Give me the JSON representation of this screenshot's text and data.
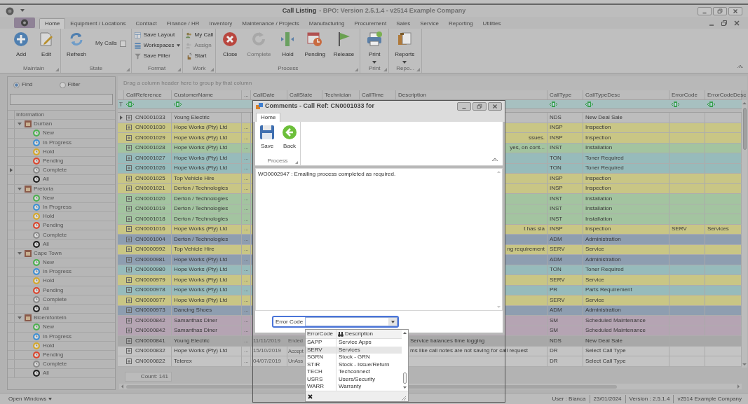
{
  "window": {
    "title": "Call Listing",
    "subtitle": "- BPO: Version 2.5.1.4 - v2514 Example Company"
  },
  "ribbon_tabs": [
    {
      "label": "Home",
      "selected": true
    },
    {
      "label": "Equipment / Locations",
      "selected": false
    },
    {
      "label": "Contract",
      "selected": false
    },
    {
      "label": "Finance / HR",
      "selected": false
    },
    {
      "label": "Inventory",
      "selected": false
    },
    {
      "label": "Maintenance / Projects",
      "selected": false
    },
    {
      "label": "Manufacturing",
      "selected": false
    },
    {
      "label": "Procurement",
      "selected": false
    },
    {
      "label": "Sales",
      "selected": false
    },
    {
      "label": "Service",
      "selected": false
    },
    {
      "label": "Reporting",
      "selected": false
    },
    {
      "label": "Utilities",
      "selected": false
    }
  ],
  "ribbon_groups": [
    {
      "label": "Maintain",
      "items": [
        {
          "kind": "large",
          "label": "Add",
          "disabled": false,
          "dropdown": false
        },
        {
          "kind": "large",
          "label": "Edit",
          "disabled": false,
          "dropdown": false
        }
      ]
    },
    {
      "label": "State",
      "items": [
        {
          "kind": "large",
          "label": "Refresh",
          "disabled": false,
          "dropdown": false
        },
        {
          "kind": "check",
          "label": "My Calls",
          "checked": false
        }
      ]
    },
    {
      "label": "Format",
      "items": [
        {
          "kind": "small",
          "label": "Save Layout",
          "disabled": false,
          "dropdown": false
        },
        {
          "kind": "small",
          "label": "Workspaces",
          "disabled": false,
          "dropdown": true
        },
        {
          "kind": "small",
          "label": "Save Filter",
          "disabled": false,
          "dropdown": false
        }
      ]
    },
    {
      "label": "Work",
      "items": [
        {
          "kind": "small",
          "label": "My Call",
          "disabled": false,
          "dropdown": false
        },
        {
          "kind": "small",
          "label": "Assign",
          "disabled": true,
          "dropdown": false
        },
        {
          "kind": "small",
          "label": "Start",
          "disabled": false,
          "dropdown": false
        }
      ]
    },
    {
      "label": "Process",
      "items": [
        {
          "kind": "large",
          "label": "Close",
          "disabled": false,
          "dropdown": false
        },
        {
          "kind": "large",
          "label": "Complete",
          "disabled": true,
          "dropdown": false
        },
        {
          "kind": "large",
          "label": "Hold",
          "disabled": false,
          "dropdown": false
        },
        {
          "kind": "large",
          "label": "Pending",
          "disabled": false,
          "dropdown": false
        },
        {
          "kind": "large",
          "label": "Release",
          "disabled": false,
          "dropdown": false
        }
      ]
    },
    {
      "label": "Print",
      "items": [
        {
          "kind": "large",
          "label": "Print",
          "disabled": false,
          "dropdown": true
        }
      ]
    },
    {
      "label": "Repo...",
      "items": [
        {
          "kind": "large",
          "label": "Reports",
          "disabled": false,
          "dropdown": true
        }
      ]
    }
  ],
  "search": {
    "options": [
      {
        "label": "Find",
        "selected": true
      },
      {
        "label": "Filter",
        "selected": false
      }
    ]
  },
  "tree": {
    "header": "Information",
    "items": [
      {
        "label": "Durban",
        "expanded": true,
        "selected": false,
        "children": [
          {
            "label": "New",
            "color": "#4caf50",
            "selected": false
          },
          {
            "label": "In Progress",
            "color": "#3f8fd2",
            "selected": false
          },
          {
            "label": "Hold",
            "color": "#d4a72c",
            "selected": false
          },
          {
            "label": "Pending",
            "color": "#d9462f",
            "selected": false
          },
          {
            "label": "Complete",
            "color": "#8a8a8a",
            "selected": true
          },
          {
            "label": "All",
            "color": "#222222",
            "selected": false
          }
        ]
      },
      {
        "label": "Pretoria",
        "expanded": true,
        "selected": false,
        "children": [
          {
            "label": "New",
            "color": "#4caf50",
            "selected": false
          },
          {
            "label": "In Progress",
            "color": "#3f8fd2",
            "selected": false
          },
          {
            "label": "Hold",
            "color": "#d4a72c",
            "selected": false
          },
          {
            "label": "Pending",
            "color": "#d9462f",
            "selected": false
          },
          {
            "label": "Complete",
            "color": "#8a8a8a",
            "selected": false
          },
          {
            "label": "All",
            "color": "#222222",
            "selected": false
          }
        ]
      },
      {
        "label": "Cape Town",
        "expanded": true,
        "selected": false,
        "children": [
          {
            "label": "New",
            "color": "#4caf50",
            "selected": false
          },
          {
            "label": "In Progress",
            "color": "#3f8fd2",
            "selected": false
          },
          {
            "label": "Hold",
            "color": "#d4a72c",
            "selected": false
          },
          {
            "label": "Pending",
            "color": "#d9462f",
            "selected": false
          },
          {
            "label": "Complete",
            "color": "#8a8a8a",
            "selected": false
          },
          {
            "label": "All",
            "color": "#222222",
            "selected": false
          }
        ]
      },
      {
        "label": "Bloemfontein",
        "expanded": true,
        "selected": false,
        "children": [
          {
            "label": "New",
            "color": "#4caf50",
            "selected": false
          },
          {
            "label": "In Progress",
            "color": "#3f8fd2",
            "selected": false
          },
          {
            "label": "Hold",
            "color": "#d4a72c",
            "selected": false
          },
          {
            "label": "Pending",
            "color": "#d9462f",
            "selected": false
          },
          {
            "label": "Complete",
            "color": "#8a8a8a",
            "selected": false
          },
          {
            "label": "All",
            "color": "#222222",
            "selected": false
          }
        ]
      }
    ]
  },
  "table": {
    "group_hint": "Drag a column header here to group by that column",
    "columns": [
      {
        "label": "CallReference",
        "filter": true
      },
      {
        "label": "CustomerName",
        "filter": true
      },
      {
        "label": "..."
      },
      {
        "label": "CallDate"
      },
      {
        "label": "CallState"
      },
      {
        "label": "Technician"
      },
      {
        "label": "CallTime"
      },
      {
        "label": "Description"
      },
      {
        "label": "CallType",
        "filter": true
      },
      {
        "label": "CallTypeDesc",
        "filter": true
      },
      {
        "label": "ErrorCode",
        "filter": true
      },
      {
        "label": "ErrorCodeDesc",
        "filter": true
      }
    ],
    "rows": [
      {
        "ref": "CN0001033",
        "customer": "Young Electric",
        "call_type": "NDS",
        "call_type_desc": "New Deal Sale",
        "color": "#bdbdbd",
        "selected": true
      },
      {
        "ref": "CN0001030",
        "customer": "Hope Works (Pty) Ltd",
        "more": "...",
        "call_type": "INSP",
        "call_type_desc": "Inspection",
        "color": "#c9c685",
        "selected": false
      },
      {
        "ref": "CN0001029",
        "customer": "Hope Works (Pty) Ltd",
        "more": "...",
        "description": "ssues.",
        "call_type": "INSP",
        "call_type_desc": "Inspection",
        "color": "#c9c685",
        "selected": false
      },
      {
        "ref": "CN0001028",
        "customer": "Hope Works (Pty) Ltd",
        "more": "...",
        "description": "yes, on cont...",
        "call_type": "INST",
        "call_type_desc": "Installation",
        "color": "#a3c4a0",
        "selected": false
      },
      {
        "ref": "CN0001027",
        "customer": "Hope Works (Pty) Ltd",
        "more": "...",
        "call_type": "TON",
        "call_type_desc": "Toner Required",
        "color": "#97bbbb",
        "selected": false
      },
      {
        "ref": "CN0001026",
        "customer": "Hope Works (Pty) Ltd",
        "more": "...",
        "call_type": "TON",
        "call_type_desc": "Toner Required",
        "color": "#97bbbb",
        "selected": false
      },
      {
        "ref": "CN0001025",
        "customer": "Top Vehicle Hire",
        "more": "...",
        "call_type": "INSP",
        "call_type_desc": "Inspection",
        "color": "#c9c685",
        "selected": false
      },
      {
        "ref": "CN0001021",
        "customer": "Derton / Technologies",
        "more": "...",
        "call_type": "INSP",
        "call_type_desc": "Inspection",
        "color": "#c9c685",
        "selected": false
      },
      {
        "ref": "CN0001020",
        "customer": "Derton / Technologies",
        "more": "...",
        "call_type": "INST",
        "call_type_desc": "Installation",
        "color": "#a3c4a0",
        "selected": false
      },
      {
        "ref": "CN0001019",
        "customer": "Derton / Technologies",
        "more": "...",
        "call_type": "INST",
        "call_type_desc": "Installation",
        "color": "#a3c4a0",
        "selected": false
      },
      {
        "ref": "CN0001018",
        "customer": "Derton / Technologies",
        "more": "...",
        "call_type": "INST",
        "call_type_desc": "Installation",
        "color": "#a3c4a0",
        "selected": false
      },
      {
        "ref": "CN0001016",
        "customer": "Hope Works (Pty) Ltd",
        "more": "...",
        "description": "t has sla",
        "call_type": "INSP",
        "call_type_desc": "Inspection",
        "error_code": "SERV",
        "error_code_desc": "Services",
        "color": "#c9c685",
        "selected": false
      },
      {
        "ref": "CN0001004",
        "customer": "Derton / Technologies",
        "more": "...",
        "call_type": "ADM",
        "call_type_desc": "Administration",
        "color": "#8e9eb0",
        "selected": false
      },
      {
        "ref": "CN0000992",
        "customer": "Top Vehicle Hire",
        "more": "...",
        "description": "ng requirement",
        "call_type": "SERV",
        "call_type_desc": "Service",
        "color": "#c9c685",
        "selected": false
      },
      {
        "ref": "CN0000981",
        "customer": "Hope Works (Pty) Ltd",
        "more": "...",
        "call_type": "ADM",
        "call_type_desc": "Administration",
        "color": "#8e9eb0",
        "selected": false
      },
      {
        "ref": "CN0000980",
        "customer": "Hope Works (Pty) Ltd",
        "more": "...",
        "call_type": "TON",
        "call_type_desc": "Toner Required",
        "color": "#97bbbb",
        "selected": false
      },
      {
        "ref": "CN0000979",
        "customer": "Hope Works (Pty) Ltd",
        "more": "...",
        "call_type": "SERV",
        "call_type_desc": "Service",
        "color": "#c9c685",
        "selected": false
      },
      {
        "ref": "CN0000978",
        "customer": "Hope Works (Pty) Ltd",
        "more": "...",
        "call_type": "PR",
        "call_type_desc": "Parts Requirement",
        "color": "#97bbbb",
        "selected": false
      },
      {
        "ref": "CN0000977",
        "customer": "Hope Works (Pty) Ltd",
        "more": "...",
        "call_type": "SERV",
        "call_type_desc": "Service",
        "color": "#c9c685",
        "selected": false
      },
      {
        "ref": "CN0000973",
        "customer": "Dancing Shoes",
        "more": "...",
        "call_type": "ADM",
        "call_type_desc": "Administration",
        "color": "#8e9eb0",
        "selected": false
      },
      {
        "ref": "CN0000842",
        "customer": "Samanthas Diner",
        "more": "...",
        "call_type": "SM",
        "call_type_desc": "Scheduled Maintenance",
        "color": "#b5a4b3",
        "selected": false
      },
      {
        "ref": "CN0000842",
        "customer": "Samanthas Diner",
        "more": "...",
        "call_type": "SM",
        "call_type_desc": "Scheduled Maintenance",
        "color": "#b5a4b3",
        "selected": false
      },
      {
        "ref": "CN0000841",
        "customer": "Young Electric",
        "more": "...",
        "date": "11/11/2019",
        "state": "Ended",
        "description": "Service balances time logging",
        "call_type": "NDS",
        "call_type_desc": "New Deal Sale",
        "color": "#a8a8a8",
        "selected": false
      },
      {
        "ref": "CN0000832",
        "customer": "Hope Works (Pty) Ltd",
        "more": "...",
        "date": "15/10/2019",
        "state": "Accept",
        "description": "ms like call notes are not saving for call request",
        "call_type": "DR",
        "call_type_desc": "Select Call Type",
        "color": "#c4c4c4",
        "selected": false
      },
      {
        "ref": "CN0000822",
        "customer": "Telerex",
        "more": "...",
        "date": "04/07/2019",
        "state": "UnAss",
        "call_type": "DR",
        "call_type_desc": "Select Call Type",
        "color": "#c4c4c4",
        "selected": false
      }
    ],
    "count": "Count: 141"
  },
  "dialog": {
    "title": "Comments - Call Ref: CN0001033 for",
    "tabs": [
      {
        "label": "Home",
        "selected": true
      }
    ],
    "buttons": [
      {
        "label": "Save"
      },
      {
        "label": "Back"
      }
    ],
    "group": "Process",
    "comment": "WO0002947 : Emailing process completed as required.",
    "field_label": "Error Code",
    "dropdown": {
      "columns": [
        "ErrorCode",
        "Description"
      ],
      "rows": [
        {
          "code": "SAPP",
          "description": "Service Apps",
          "selected": false
        },
        {
          "code": "SERV",
          "description": "Services",
          "selected": true
        },
        {
          "code": "SGRN",
          "description": "Stock - GRN",
          "selected": false
        },
        {
          "code": "STIR",
          "description": "Stock - Issue/Return",
          "selected": false
        },
        {
          "code": "TECH",
          "description": "Techconnect",
          "selected": false
        },
        {
          "code": "USRS",
          "description": "Users/Security",
          "selected": false
        },
        {
          "code": "WARR",
          "description": "Warranty",
          "selected": false
        }
      ]
    }
  },
  "status_bar": {
    "open_windows": "Open Windows",
    "items": [
      "User : Bianca",
      "23/01/2024",
      "Version : 2.5.1.4",
      "v2514 Example Company"
    ]
  }
}
